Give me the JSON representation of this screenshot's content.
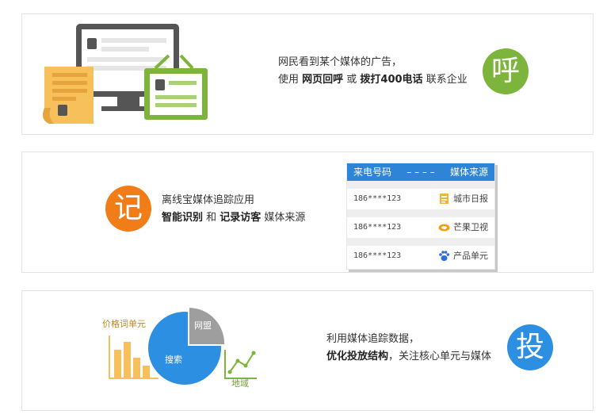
{
  "panel1": {
    "line1": "网民看到某个媒体的广告，",
    "line2_pre": "使用 ",
    "line2_b1": "网页回呼",
    "line2_mid": " 或 ",
    "line2_b2": "拨打400电话",
    "line2_post": " 联系企业",
    "badge": "呼"
  },
  "panel2": {
    "badge": "记",
    "line1": "离线宝媒体追踪应用",
    "line2_b1": "智能识别",
    "line2_mid": " 和 ",
    "line2_b2": "记录访客",
    "line2_post": " 媒体来源",
    "table": {
      "col1": "来电号码",
      "sep": "– – – –",
      "col2": "媒体来源",
      "rows": [
        {
          "phone": "186****123",
          "media": "城市日报",
          "icon": "newspaper-icon"
        },
        {
          "phone": "186****123",
          "media": "芒果卫视",
          "icon": "mango-tv-icon"
        },
        {
          "phone": "186****123",
          "media": "产品单元",
          "icon": "paw-icon"
        }
      ]
    }
  },
  "panel3": {
    "label_price": "价格词单元",
    "label_union": "网盟",
    "label_search": "搜索",
    "label_region": "地域",
    "line1": "利用媒体追踪数据，",
    "line2_b1": "优化投放结构",
    "line2_post": "，关注核心单元与媒体",
    "badge": "投"
  },
  "colors": {
    "green": "#7db53c",
    "orange": "#f07d18",
    "blue": "#2d8fe2",
    "paper": "#f7c05a",
    "monitor": "#555555"
  }
}
